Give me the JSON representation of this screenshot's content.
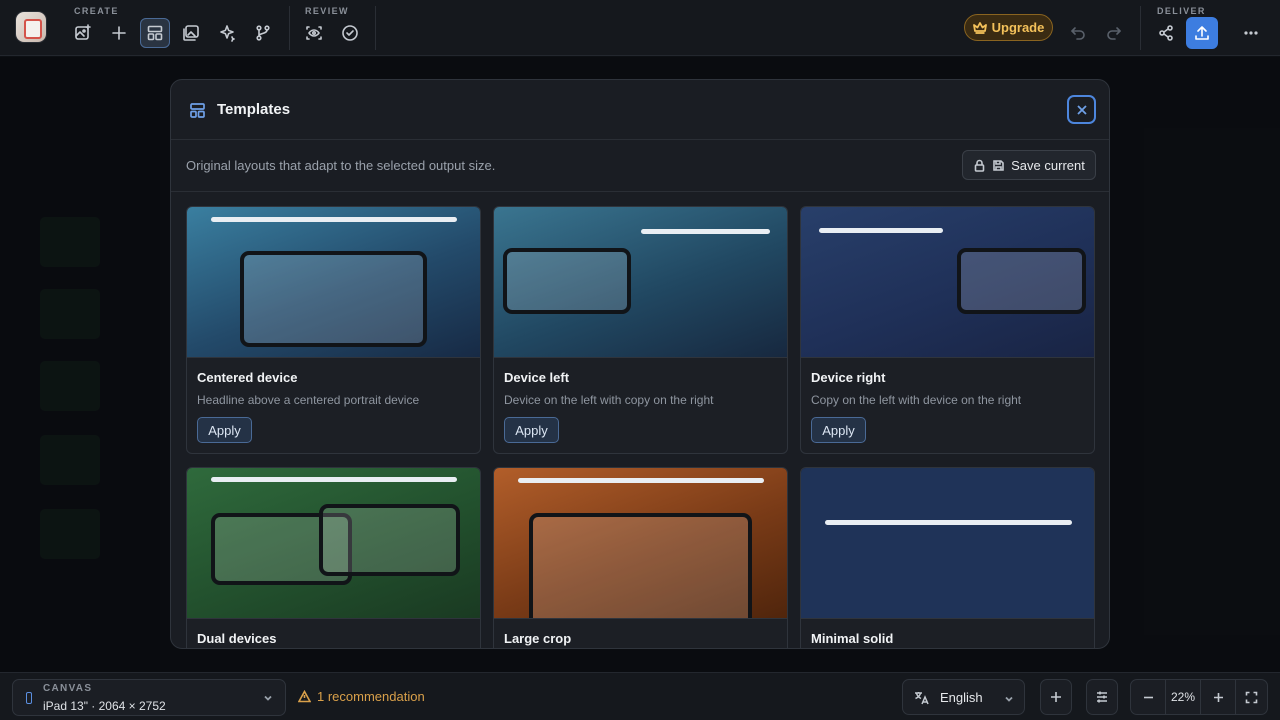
{
  "toolbar": {
    "create_label": "CREATE",
    "review_label": "REVIEW",
    "deliver_label": "DELIVER",
    "upgrade_label": "Upgrade",
    "icons": [
      "image-add-icon",
      "plus-icon",
      "templates-icon",
      "gallery-icon",
      "sparkle-icon",
      "branch-icon",
      "eye-scan-icon",
      "check-circle-icon",
      "undo-icon",
      "redo-icon",
      "share-icon",
      "export-icon",
      "more-icon"
    ]
  },
  "modal": {
    "title": "Templates",
    "subtitle": "Original layouts that adapt to the selected output size.",
    "save_label": "Save current",
    "templates": [
      {
        "name": "Centered device",
        "description": "Headline above a centered portrait device",
        "apply": "Apply"
      },
      {
        "name": "Device left",
        "description": "Device on the left with copy on the right",
        "apply": "Apply"
      },
      {
        "name": "Device right",
        "description": "Copy on the left with device on the right",
        "apply": "Apply"
      },
      {
        "name": "Dual devices"
      },
      {
        "name": "Large crop"
      },
      {
        "name": "Minimal solid"
      }
    ]
  },
  "bottombar": {
    "canvas_label": "CANVAS",
    "canvas_value": "iPad 13\" · 2064 × 2752",
    "recommendation": "1 recommendation",
    "language": "English",
    "zoom": "22%"
  },
  "colors": {
    "accent": "#3d7de0",
    "upgrade": "#f3c15a",
    "warning": "#d9a04a"
  }
}
